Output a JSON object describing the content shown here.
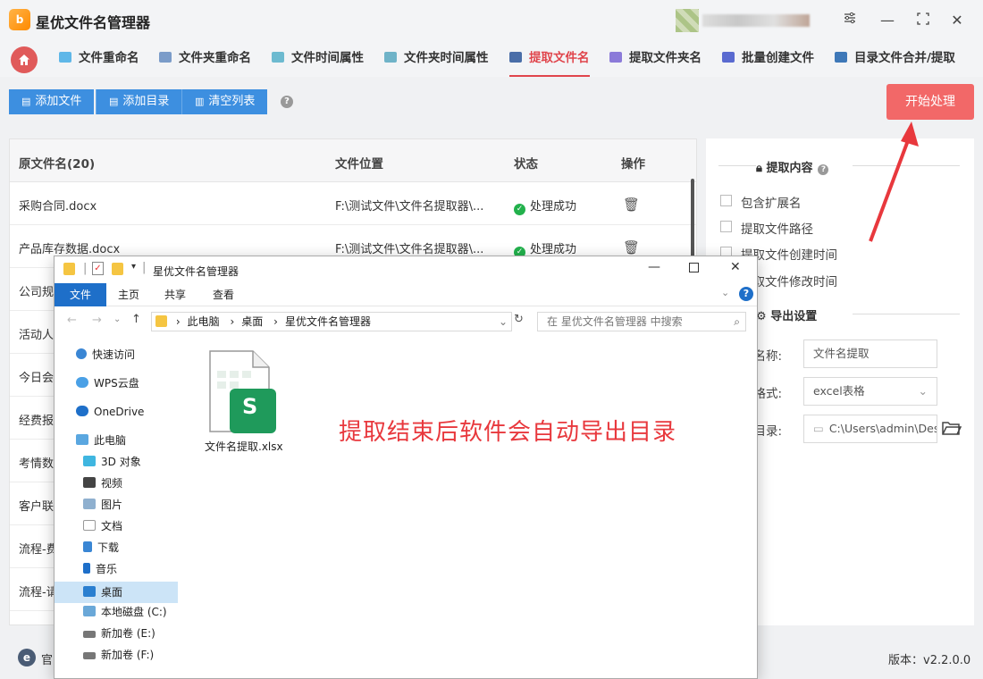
{
  "app": {
    "logo_text": "b",
    "title": "星优文件名管理器"
  },
  "window_controls": {
    "settings_icon": "sliders-icon",
    "minimize": "—",
    "maximize": "⛶",
    "close": "✕"
  },
  "tabs": [
    {
      "label": "文件重命名",
      "active": false
    },
    {
      "label": "文件夹重命名",
      "active": false
    },
    {
      "label": "文件时间属性",
      "active": false
    },
    {
      "label": "文件夹时间属性",
      "active": false
    },
    {
      "label": "提取文件名",
      "active": true
    },
    {
      "label": "提取文件夹名",
      "active": false
    },
    {
      "label": "批量创建文件",
      "active": false
    },
    {
      "label": "目录文件合并/提取",
      "active": false
    }
  ],
  "toolbar": {
    "add_file": "添加文件",
    "add_dir": "添加目录",
    "clear_list": "清空列表",
    "help": "?",
    "start": "开始处理"
  },
  "table": {
    "headers": {
      "name": "原文件名(20)",
      "location": "文件位置",
      "status": "状态",
      "action": "操作"
    },
    "rows": [
      {
        "name": "采购合同.docx",
        "location": "F:\\测试文件\\文件名提取器\\...",
        "status": "处理成功"
      },
      {
        "name": "产品库存数据.docx",
        "location": "F:\\测试文件\\文件名提取器\\...",
        "status": "处理成功"
      },
      {
        "name": "公司规",
        "location": "",
        "status": ""
      },
      {
        "name": "活动人",
        "location": "",
        "status": ""
      },
      {
        "name": "今日会",
        "location": "",
        "status": ""
      },
      {
        "name": "经费报",
        "location": "",
        "status": ""
      },
      {
        "name": "考情数",
        "location": "",
        "status": ""
      },
      {
        "name": "客户联",
        "location": "",
        "status": ""
      },
      {
        "name": "流程-费",
        "location": "",
        "status": ""
      },
      {
        "name": "流程-请",
        "location": "",
        "status": ""
      }
    ]
  },
  "panel": {
    "extract_title": "提取内容",
    "help": "?",
    "options": [
      "包含扩展名",
      "提取文件路径",
      "提取文件创建时间",
      "提取文件修改时间"
    ],
    "export_title": "导出设置",
    "export_name_label": "出名称:",
    "export_name_value": "文件名提取",
    "export_format_label": "出格式:",
    "export_format_value": "excel表格",
    "export_dir_label": "出目录:",
    "export_dir_value": "C:\\Users\\admin\\Des"
  },
  "status": {
    "site_label": "官",
    "version": "版本：v2.2.0.0"
  },
  "explorer": {
    "title": "星优文件名管理器",
    "ribbon_tabs": [
      "文件",
      "主页",
      "共享",
      "查看"
    ],
    "breadcrumb": [
      "此电脑",
      "桌面",
      "星优文件名管理器"
    ],
    "search_placeholder": "在 星优文件名管理器 中搜索",
    "nav": [
      {
        "label": "快速访问",
        "icon": "star-icon",
        "selected": false
      },
      {
        "label": "WPS云盘",
        "icon": "cloud-icon",
        "selected": false
      },
      {
        "label": "OneDrive",
        "icon": "onedrive-icon",
        "selected": false
      },
      {
        "label": "此电脑",
        "icon": "computer-icon",
        "selected": false
      },
      {
        "label": "3D 对象",
        "icon": "cube-icon",
        "selected": false
      },
      {
        "label": "视频",
        "icon": "video-icon",
        "selected": false
      },
      {
        "label": "图片",
        "icon": "picture-icon",
        "selected": false
      },
      {
        "label": "文档",
        "icon": "document-icon",
        "selected": false
      },
      {
        "label": "下载",
        "icon": "download-icon",
        "selected": false
      },
      {
        "label": "音乐",
        "icon": "music-icon",
        "selected": false
      },
      {
        "label": "桌面",
        "icon": "desktop-icon",
        "selected": true
      },
      {
        "label": "本地磁盘 (C:)",
        "icon": "disk-icon",
        "selected": false
      },
      {
        "label": "新加卷 (E:)",
        "icon": "drive-icon",
        "selected": false
      },
      {
        "label": "新加卷 (F:)",
        "icon": "drive-icon",
        "selected": false
      }
    ],
    "file_name": "文件名提取.xlsx",
    "file_badge": "S"
  },
  "annotation": "提取结束后软件会自动导出目录",
  "colors": {
    "accent_red": "#e0454c",
    "button_blue": "#3d8fe0",
    "start_red": "#f26868",
    "success_green": "#22b14c"
  }
}
